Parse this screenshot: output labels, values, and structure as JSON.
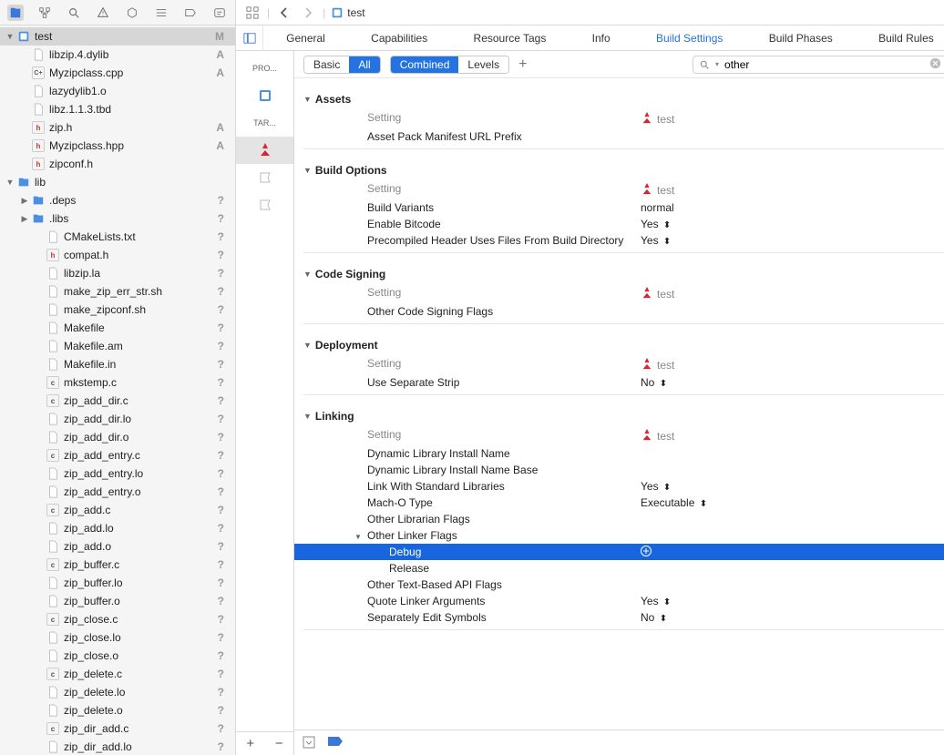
{
  "breadcrumb": {
    "label": "test"
  },
  "tabs": {
    "general": "General",
    "capabilities": "Capabilities",
    "resource_tags": "Resource Tags",
    "info": "Info",
    "build_settings": "Build Settings",
    "build_phases": "Build Phases",
    "build_rules": "Build Rules"
  },
  "targets_col": {
    "project_label": "PRO...",
    "targets_label": "TAR..."
  },
  "filter": {
    "basic": "Basic",
    "all": "All",
    "combined": "Combined",
    "levels": "Levels",
    "search_value": "other"
  },
  "columns": {
    "setting": "Setting",
    "target_name": "test"
  },
  "sections": {
    "assets": {
      "title": "Assets",
      "rows": [
        {
          "label": "Asset Pack Manifest URL Prefix",
          "value": ""
        }
      ]
    },
    "build_options": {
      "title": "Build Options",
      "rows": [
        {
          "label": "Build Variants",
          "value": "normal"
        },
        {
          "label": "Enable Bitcode",
          "value": "Yes",
          "updown": true
        },
        {
          "label": "Precompiled Header Uses Files From Build Directory",
          "value": "Yes",
          "updown": true
        }
      ]
    },
    "code_signing": {
      "title": "Code Signing",
      "rows": [
        {
          "label": "Other Code Signing Flags",
          "value": ""
        }
      ]
    },
    "deployment": {
      "title": "Deployment",
      "rows": [
        {
          "label": "Use Separate Strip",
          "value": "No",
          "updown": true
        }
      ]
    },
    "linking": {
      "title": "Linking",
      "rows": [
        {
          "label": "Dynamic Library Install Name",
          "value": ""
        },
        {
          "label": "Dynamic Library Install Name Base",
          "value": ""
        },
        {
          "label": "Link With Standard Libraries",
          "value": "Yes",
          "updown": true
        },
        {
          "label": "Mach-O Type",
          "value": "Executable",
          "updown": true
        },
        {
          "label": "Other Librarian Flags",
          "value": ""
        },
        {
          "label": "Other Linker Flags",
          "value": "",
          "expandable": true
        },
        {
          "label": "Debug",
          "value": "",
          "indent": true,
          "selected": true,
          "add": true
        },
        {
          "label": "Release",
          "value": "",
          "indent": true
        },
        {
          "label": "Other Text-Based API Flags",
          "value": ""
        },
        {
          "label": "Quote Linker Arguments",
          "value": "Yes",
          "updown": true
        },
        {
          "label": "Separately Edit Symbols",
          "value": "No",
          "updown": true
        }
      ]
    }
  },
  "file_tree": [
    {
      "label": "test",
      "indent": 0,
      "icon": "xcproj",
      "disc": "down",
      "badge": "M",
      "sel": true
    },
    {
      "label": "libzip.4.dylib",
      "indent": 1,
      "icon": "generic",
      "badge": "A"
    },
    {
      "label": "Myzipclass.cpp",
      "indent": 1,
      "icon": "cpp",
      "badge": "A"
    },
    {
      "label": "lazydylib1.o",
      "indent": 1,
      "icon": "generic"
    },
    {
      "label": "libz.1.1.3.tbd",
      "indent": 1,
      "icon": "generic"
    },
    {
      "label": "zip.h",
      "indent": 1,
      "icon": "h",
      "badge": "A"
    },
    {
      "label": "Myzipclass.hpp",
      "indent": 1,
      "icon": "h",
      "badge": "A"
    },
    {
      "label": "zipconf.h",
      "indent": 1,
      "icon": "h"
    },
    {
      "label": "lib",
      "indent": 0,
      "icon": "folder",
      "disc": "down"
    },
    {
      "label": ".deps",
      "indent": 1,
      "icon": "folder",
      "disc": "right",
      "badge": "?"
    },
    {
      "label": ".libs",
      "indent": 1,
      "icon": "folder",
      "disc": "right",
      "badge": "?"
    },
    {
      "label": "CMakeLists.txt",
      "indent": 2,
      "icon": "generic",
      "badge": "?"
    },
    {
      "label": "compat.h",
      "indent": 2,
      "icon": "h",
      "badge": "?"
    },
    {
      "label": "libzip.la",
      "indent": 2,
      "icon": "generic",
      "badge": "?"
    },
    {
      "label": "make_zip_err_str.sh",
      "indent": 2,
      "icon": "generic",
      "badge": "?"
    },
    {
      "label": "make_zipconf.sh",
      "indent": 2,
      "icon": "generic",
      "badge": "?"
    },
    {
      "label": "Makefile",
      "indent": 2,
      "icon": "generic",
      "badge": "?"
    },
    {
      "label": "Makefile.am",
      "indent": 2,
      "icon": "generic",
      "badge": "?"
    },
    {
      "label": "Makefile.in",
      "indent": 2,
      "icon": "generic",
      "badge": "?"
    },
    {
      "label": "mkstemp.c",
      "indent": 2,
      "icon": "c",
      "badge": "?"
    },
    {
      "label": "zip_add_dir.c",
      "indent": 2,
      "icon": "c",
      "badge": "?"
    },
    {
      "label": "zip_add_dir.lo",
      "indent": 2,
      "icon": "generic",
      "badge": "?"
    },
    {
      "label": "zip_add_dir.o",
      "indent": 2,
      "icon": "generic",
      "badge": "?"
    },
    {
      "label": "zip_add_entry.c",
      "indent": 2,
      "icon": "c",
      "badge": "?"
    },
    {
      "label": "zip_add_entry.lo",
      "indent": 2,
      "icon": "generic",
      "badge": "?"
    },
    {
      "label": "zip_add_entry.o",
      "indent": 2,
      "icon": "generic",
      "badge": "?"
    },
    {
      "label": "zip_add.c",
      "indent": 2,
      "icon": "c",
      "badge": "?"
    },
    {
      "label": "zip_add.lo",
      "indent": 2,
      "icon": "generic",
      "badge": "?"
    },
    {
      "label": "zip_add.o",
      "indent": 2,
      "icon": "generic",
      "badge": "?"
    },
    {
      "label": "zip_buffer.c",
      "indent": 2,
      "icon": "c",
      "badge": "?"
    },
    {
      "label": "zip_buffer.lo",
      "indent": 2,
      "icon": "generic",
      "badge": "?"
    },
    {
      "label": "zip_buffer.o",
      "indent": 2,
      "icon": "generic",
      "badge": "?"
    },
    {
      "label": "zip_close.c",
      "indent": 2,
      "icon": "c",
      "badge": "?"
    },
    {
      "label": "zip_close.lo",
      "indent": 2,
      "icon": "generic",
      "badge": "?"
    },
    {
      "label": "zip_close.o",
      "indent": 2,
      "icon": "generic",
      "badge": "?"
    },
    {
      "label": "zip_delete.c",
      "indent": 2,
      "icon": "c",
      "badge": "?"
    },
    {
      "label": "zip_delete.lo",
      "indent": 2,
      "icon": "generic",
      "badge": "?"
    },
    {
      "label": "zip_delete.o",
      "indent": 2,
      "icon": "generic",
      "badge": "?"
    },
    {
      "label": "zip_dir_add.c",
      "indent": 2,
      "icon": "c",
      "badge": "?"
    },
    {
      "label": "zip_dir_add.lo",
      "indent": 2,
      "icon": "generic",
      "badge": "?"
    }
  ]
}
